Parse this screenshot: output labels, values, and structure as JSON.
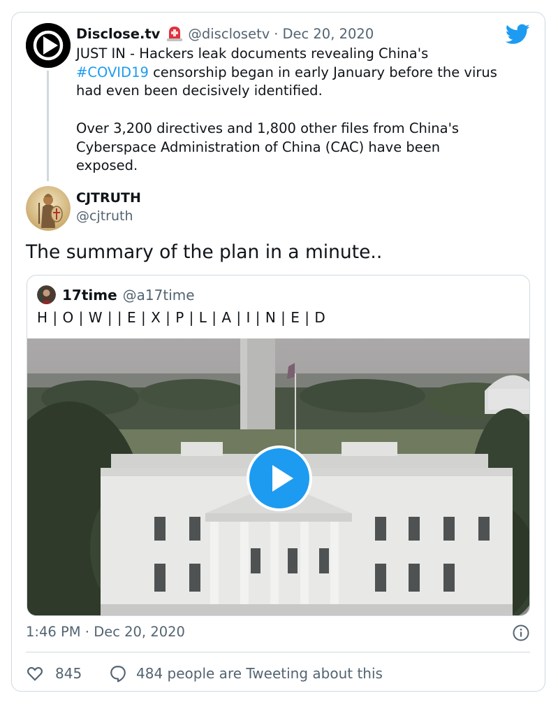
{
  "parent_tweet": {
    "author_name": "Disclose.tv",
    "author_handle": "@disclosetv",
    "date": "Dec 20, 2020",
    "text_line1": "JUST IN - Hackers leak documents revealing China's",
    "hashtag": "#COVID19",
    "text_line2_rest": " censorship began in early January before the virus",
    "text_line3": "had even been decisively identified.",
    "text_line4": "Over 3,200 directives and 1,800 other files from China's",
    "text_line5": "Cyberspace Administration of China (CAC) have been",
    "text_line6": "exposed."
  },
  "tweet": {
    "author_name": "CJTRUTH",
    "author_handle": "@cjtruth",
    "text": "The summary of the plan in a minute..",
    "time": "1:46 PM",
    "date": "Dec 20, 2020",
    "likes": "845",
    "replies_text": "484 people are Tweeting about this"
  },
  "quoted_tweet": {
    "author_name": "17time",
    "author_handle": "@a17time",
    "text": "H | O | W | | E | X | P | L | A | I | N | E | D"
  },
  "icons": {
    "brand": "twitter-bird-icon",
    "siren": "police-light-icon",
    "play": "play-icon",
    "info": "info-icon",
    "like": "heart-icon",
    "reply": "speech-bubble-icon"
  },
  "colors": {
    "accent": "#1d9bf0",
    "muted": "#536471",
    "border": "#cfd9de"
  }
}
